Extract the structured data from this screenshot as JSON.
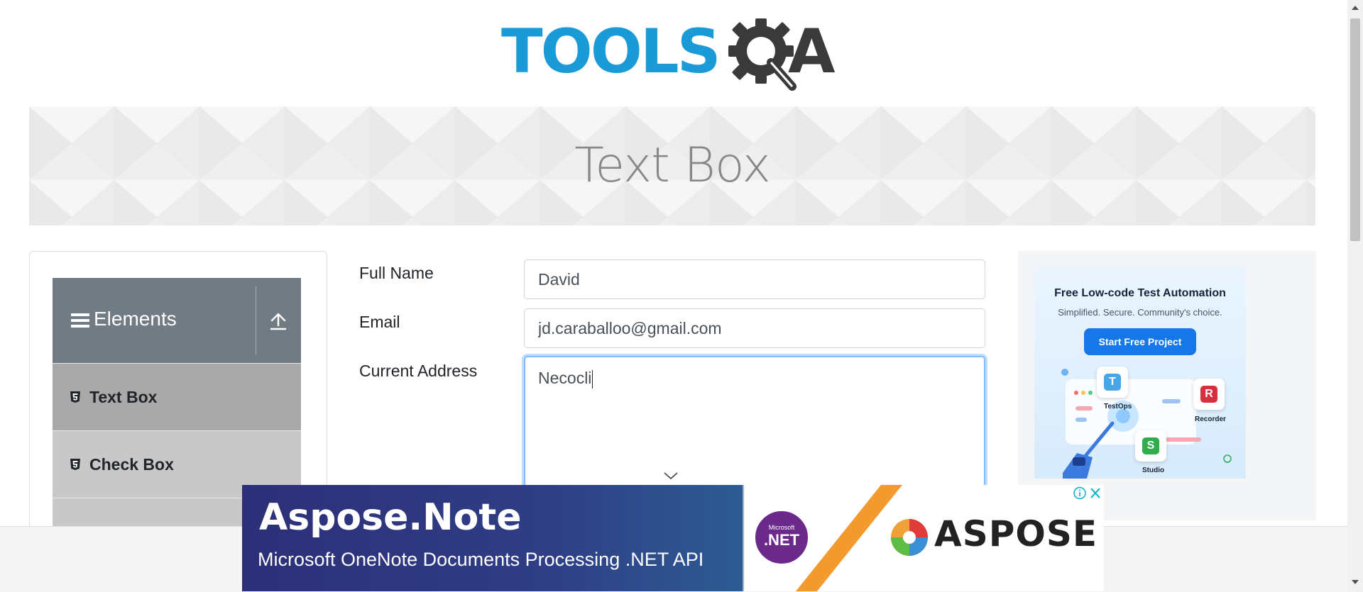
{
  "logo": {
    "brand_part1": "TOOLS",
    "brand_part2": "A",
    "colors": {
      "tools": "#1a9ad6",
      "qa": "#3a3a3a"
    }
  },
  "banner": {
    "title": "Text Box"
  },
  "sidebar": {
    "group_label": "Elements",
    "group_icon": "hamburger-icon",
    "collapse_icon": "upload-arrow-icon",
    "items": [
      {
        "label": "Text Box",
        "icon": "html5-icon",
        "active": true
      },
      {
        "label": "Check Box",
        "icon": "html5-icon",
        "active": false
      }
    ]
  },
  "form": {
    "full_name_label": "Full Name",
    "full_name_value": "David",
    "email_label": "Email",
    "email_value": "jd.caraballoo@gmail.com",
    "address_label": "Current Address",
    "address_value": "Necocli"
  },
  "right_ad": {
    "title": "Free Low-code Test Automation",
    "subtitle": "Simplified. Secure. Community's choice.",
    "button": "Start Free Project",
    "products": [
      "TestOps",
      "Recorder",
      "Studio"
    ]
  },
  "bottom_ad": {
    "title": "Aspose.Note",
    "tagline": "Microsoft OneNote Documents Processing .NET API",
    "badge_small": "Microsoft",
    "badge_main": ".NET",
    "brand": "ASPOSE"
  },
  "colors": {
    "accent": "#1a9ad6",
    "sidebar_header": "#707b84",
    "focus_border": "#80bdff"
  }
}
